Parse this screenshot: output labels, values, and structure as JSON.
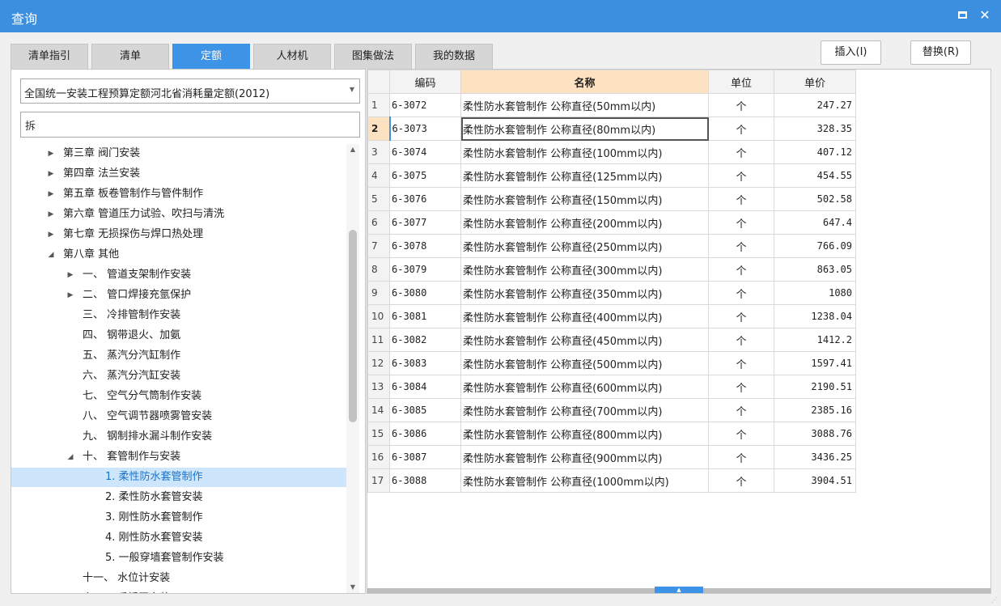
{
  "window": {
    "title": "查询",
    "maximize_icon": "maximize-icon",
    "close_label": "✕"
  },
  "tabs": [
    {
      "label": "清单指引",
      "active": false
    },
    {
      "label": "清单",
      "active": false
    },
    {
      "label": "定额",
      "active": true
    },
    {
      "label": "人材机",
      "active": false
    },
    {
      "label": "图集做法",
      "active": false
    },
    {
      "label": "我的数据",
      "active": false
    }
  ],
  "actions": {
    "insert_label": "插入(I)",
    "replace_label": "替换(R)"
  },
  "left_panel": {
    "quota_library": "全国统一安装工程预算定额河北省消耗量定额(2012)",
    "search_value": "拆",
    "tree": [
      {
        "label": "第三章 阀门安装",
        "toggle": "collapsed",
        "level": 0
      },
      {
        "label": "第四章 法兰安装",
        "toggle": "collapsed",
        "level": 0
      },
      {
        "label": "第五章 板卷管制作与管件制作",
        "toggle": "collapsed",
        "level": 0
      },
      {
        "label": "第六章 管道压力试验、吹扫与清洗",
        "toggle": "collapsed",
        "level": 0
      },
      {
        "label": "第七章 无损探伤与焊口热处理",
        "toggle": "collapsed",
        "level": 0
      },
      {
        "label": "第八章 其他",
        "toggle": "expanded",
        "level": 0
      },
      {
        "label": "一、 管道支架制作安装",
        "toggle": "collapsed",
        "level": 1
      },
      {
        "label": "二、 管口焊接充氩保护",
        "toggle": "collapsed",
        "level": 1
      },
      {
        "label": "三、 冷排管制作安装",
        "toggle": "none",
        "level": 1
      },
      {
        "label": "四、 钢带退火、加氨",
        "toggle": "none",
        "level": 1
      },
      {
        "label": "五、 蒸汽分汽缸制作",
        "toggle": "none",
        "level": 1
      },
      {
        "label": "六、 蒸汽分汽缸安装",
        "toggle": "none",
        "level": 1
      },
      {
        "label": "七、 空气分气筒制作安装",
        "toggle": "none",
        "level": 1
      },
      {
        "label": "八、 空气调节器喷雾管安装",
        "toggle": "none",
        "level": 1
      },
      {
        "label": "九、 钢制排水漏斗制作安装",
        "toggle": "none",
        "level": 1
      },
      {
        "label": "十、 套管制作与安装",
        "toggle": "expanded",
        "level": 1
      },
      {
        "label": "1. 柔性防水套管制作",
        "toggle": "none",
        "level": 2,
        "selected": true
      },
      {
        "label": "2. 柔性防水套管安装",
        "toggle": "none",
        "level": 2
      },
      {
        "label": "3. 刚性防水套管制作",
        "toggle": "none",
        "level": 2
      },
      {
        "label": "4. 刚性防水套管安装",
        "toggle": "none",
        "level": 2
      },
      {
        "label": "5. 一般穿墙套管制作安装",
        "toggle": "none",
        "level": 2
      },
      {
        "label": "十一、 水位计安装",
        "toggle": "none",
        "level": 1
      },
      {
        "label": "十二、 手摇泵安装",
        "toggle": "none",
        "level": 1
      }
    ]
  },
  "grid": {
    "columns": [
      "编码",
      "名称",
      "单位",
      "单价"
    ],
    "current_row": 2,
    "rows": [
      {
        "no": "1",
        "code": "6-3072",
        "name": "柔性防水套管制作 公称直径(50mm以内)",
        "unit": "个",
        "price": "247.27"
      },
      {
        "no": "2",
        "code": "6-3073",
        "name": "柔性防水套管制作 公称直径(80mm以内)",
        "unit": "个",
        "price": "328.35"
      },
      {
        "no": "3",
        "code": "6-3074",
        "name": "柔性防水套管制作 公称直径(100mm以内)",
        "unit": "个",
        "price": "407.12"
      },
      {
        "no": "4",
        "code": "6-3075",
        "name": "柔性防水套管制作 公称直径(125mm以内)",
        "unit": "个",
        "price": "454.55"
      },
      {
        "no": "5",
        "code": "6-3076",
        "name": "柔性防水套管制作 公称直径(150mm以内)",
        "unit": "个",
        "price": "502.58"
      },
      {
        "no": "6",
        "code": "6-3077",
        "name": "柔性防水套管制作 公称直径(200mm以内)",
        "unit": "个",
        "price": "647.4"
      },
      {
        "no": "7",
        "code": "6-3078",
        "name": "柔性防水套管制作 公称直径(250mm以内)",
        "unit": "个",
        "price": "766.09"
      },
      {
        "no": "8",
        "code": "6-3079",
        "name": "柔性防水套管制作 公称直径(300mm以内)",
        "unit": "个",
        "price": "863.05"
      },
      {
        "no": "9",
        "code": "6-3080",
        "name": "柔性防水套管制作 公称直径(350mm以内)",
        "unit": "个",
        "price": "1080"
      },
      {
        "no": "10",
        "code": "6-3081",
        "name": "柔性防水套管制作 公称直径(400mm以内)",
        "unit": "个",
        "price": "1238.04"
      },
      {
        "no": "11",
        "code": "6-3082",
        "name": "柔性防水套管制作 公称直径(450mm以内)",
        "unit": "个",
        "price": "1412.2"
      },
      {
        "no": "12",
        "code": "6-3083",
        "name": "柔性防水套管制作 公称直径(500mm以内)",
        "unit": "个",
        "price": "1597.41"
      },
      {
        "no": "13",
        "code": "6-3084",
        "name": "柔性防水套管制作 公称直径(600mm以内)",
        "unit": "个",
        "price": "2190.51"
      },
      {
        "no": "14",
        "code": "6-3085",
        "name": "柔性防水套管制作 公称直径(700mm以内)",
        "unit": "个",
        "price": "2385.16"
      },
      {
        "no": "15",
        "code": "6-3086",
        "name": "柔性防水套管制作 公称直径(800mm以内)",
        "unit": "个",
        "price": "3088.76"
      },
      {
        "no": "16",
        "code": "6-3087",
        "name": "柔性防水套管制作 公称直径(900mm以内)",
        "unit": "个",
        "price": "3436.25"
      },
      {
        "no": "17",
        "code": "6-3088",
        "name": "柔性防水套管制作 公称直径(1000mm以内)",
        "unit": "个",
        "price": "3904.51"
      }
    ]
  },
  "colors": {
    "accent": "#3d94e6",
    "titlebar": "#3b8fde",
    "header_highlight": "#fde2c2",
    "tree_selected": "#cde6fb"
  }
}
